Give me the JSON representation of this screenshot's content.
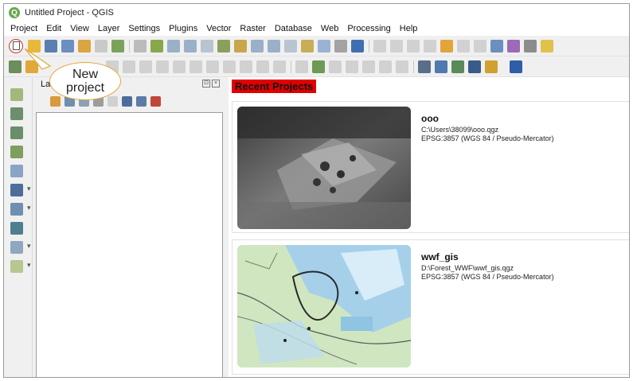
{
  "window": {
    "title": "Untitled Project - QGIS",
    "logo_letter": "Q"
  },
  "menubar": {
    "items": [
      "Project",
      "Edit",
      "View",
      "Layer",
      "Settings",
      "Plugins",
      "Vector",
      "Raster",
      "Database",
      "Web",
      "Processing",
      "Help"
    ]
  },
  "callout": {
    "line1": "New",
    "line2": "project",
    "border_color": "#e0a83a"
  },
  "toolbar": {
    "new_project_icon": "new-page-icon",
    "highlight_color": "#c8362b"
  },
  "layers_panel": {
    "title": "La",
    "controls": [
      "⊡",
      "×"
    ]
  },
  "recent": {
    "header": "Recent Projects",
    "header_color": "#e00000",
    "projects": [
      {
        "name": "ooo",
        "path": "C:\\Users\\38099\\ooo.qgz",
        "crs": "EPSG:3857 (WGS 84 / Pseudo-Mercator)"
      },
      {
        "name": "wwf_gis",
        "path": "D:\\Forest_WWF\\wwf_gis.qgz",
        "crs": "EPSG:3857 (WGS 84 / Pseudo-Mercator)"
      }
    ]
  }
}
